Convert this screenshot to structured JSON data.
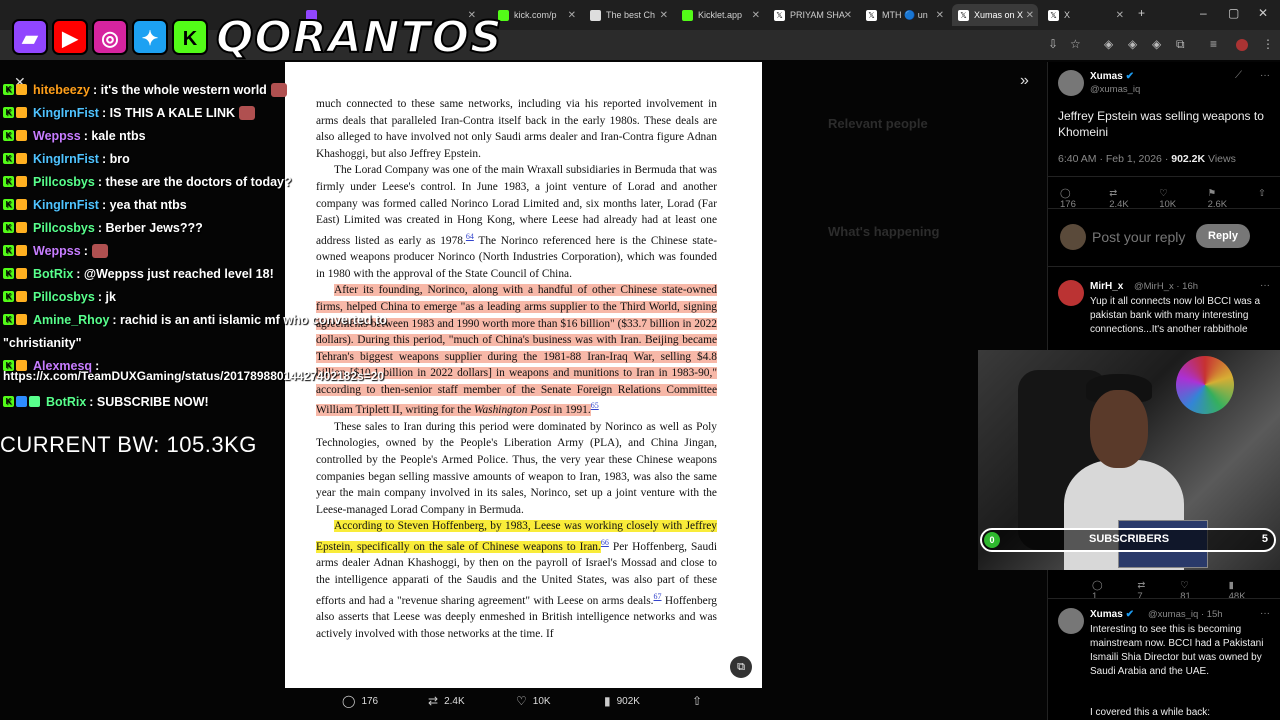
{
  "browser": {
    "tabs": [
      {
        "label": "",
        "color": "#9146ff"
      },
      {
        "label": "kick.com/p",
        "color": "#53fc18"
      },
      {
        "label": "The best Ch",
        "color": "#dddddd"
      },
      {
        "label": "Kicklet.app",
        "color": "#53fc18"
      },
      {
        "label": "PRIYAM SHA",
        "color": "#ffffff"
      },
      {
        "label": "MTH 🔵 un",
        "color": "#ffffff"
      },
      {
        "label": "Xumas on X",
        "color": "#ffffff"
      },
      {
        "label": "X",
        "color": "#ffffff"
      }
    ],
    "new_tab": "+",
    "window_controls": [
      "–",
      "▢",
      "✕"
    ]
  },
  "overlay": {
    "brand": "QORANTOS",
    "socials": [
      {
        "icon": "twitch-icon",
        "glyph": "▰",
        "color": "#9146ff"
      },
      {
        "icon": "youtube-icon",
        "glyph": "▶",
        "color": "#ff0000"
      },
      {
        "icon": "instagram-icon",
        "glyph": "◎",
        "color": "#d6249f"
      },
      {
        "icon": "twitter-icon",
        "glyph": "✦",
        "color": "#1da1f2"
      },
      {
        "icon": "kick-icon",
        "glyph": "K",
        "color": "#53fc18"
      }
    ],
    "current_bw": "CURRENT BW: 105.3KG"
  },
  "chat": [
    {
      "user": "hitebeezy",
      "color": "#ff9f1a",
      "msg": ": it's the whole western world",
      "emote": true
    },
    {
      "user": "KingIrnFist",
      "color": "#4fc3ff",
      "msg": ": IS THIS A KALE LINK",
      "emote": true
    },
    {
      "user": "Weppss",
      "color": "#c77dff",
      "msg": ": kale ntbs",
      "emote": false
    },
    {
      "user": "KingIrnFist",
      "color": "#4fc3ff",
      "msg": ": bro",
      "emote": false
    },
    {
      "user": "Pillcosbys",
      "color": "#58ff8c",
      "msg": ": these are the doctors of today?",
      "emote": false
    },
    {
      "user": "KingIrnFist",
      "color": "#4fc3ff",
      "msg": ": yea that ntbs",
      "emote": false
    },
    {
      "user": "Pillcosbys",
      "color": "#58ff8c",
      "msg": ": Berber Jews???",
      "emote": false
    },
    {
      "user": "Weppss",
      "color": "#c77dff",
      "msg": ":",
      "emote": true
    },
    {
      "user": "BotRix",
      "color": "#58ff8c",
      "msg": ": @Weppss just reached level 18!",
      "emote": false
    },
    {
      "user": "Pillcosbys",
      "color": "#58ff8c",
      "msg": ": jk",
      "emote": false
    },
    {
      "user": "Amine_Rhoy",
      "color": "#58ff8c",
      "msg": ": rachid is an anti islamic mf who converted to",
      "emote": false
    },
    {
      "user": "",
      "color": "#ffffff",
      "msg": "\"christianity\"",
      "emote": false
    },
    {
      "user": "Alexmesq",
      "color": "#c77dff",
      "msg": ":",
      "emote": false
    }
  ],
  "chat_link": "https://x.com/TeamDUXGaming/status/20178988014427402182s=20",
  "chat_last": {
    "user": "BotRix",
    "color": "#58ff8c",
    "msg": ": SUBSCRIBE NOW!"
  },
  "book": {
    "p1": "much connected to these same networks, including via his reported involvement in arms deals that paralleled Iran-Contra itself back in the early 1980s. These deals are also alleged to have involved not only Saudi arms dealer and Iran-Contra figure Adnan Khashoggi, but also Jeffrey Epstein.",
    "p2a": "The Lorad Company was one of the main Wraxall subsidiaries in Bermuda that was firmly under Leese's control. In June 1983, a joint venture of Lorad and another company was formed called Norinco Lorad Limited and, six months later, Lorad (Far East) Limited was created in Hong Kong, where Leese had already had at least one address listed as early as 1978.",
    "fn64": "64",
    "p2b": " The Norinco referenced here is the Chinese state-owned weapons producer Norinco (North Industries Corporation), which was founded in 1980 with the approval of the State Council of China.",
    "p3a": "After its founding, Norinco, along with a handful of other Chinese state-owned firms, helped China to emerge \"as a leading arms supplier to the Third World, signing agreements between 1983 and 1990 worth more than $16 billion\" ($33.7 billion in 2022 dollars). During this period, \"much of China's business was with Iran. Beijing became Tehran's biggest weapons supplier during the 1981-88 Iran-Iraq War, selling $4.8 billion [$10.1 billion in 2022 dollars] in weapons and munitions to Iran in 1983-90,\" according to then-senior staff member of the Senate Foreign Relations Committee William Triplett II, writing for the ",
    "p3_italic": "Washington Post",
    "p3b": " in 1991.",
    "fn65": "65",
    "p4": "These sales to Iran during this period were dominated by Norinco as well as Poly Technologies, owned by the People's Liberation Army (PLA), and China Jingan, controlled by the People's Armed Police. Thus, the very year these Chinese weapons companies began selling massive amounts of weapon to Iran, 1983, was also the same year the main company involved in its sales, Norinco, set up a joint venture with the Leese-managed Lorad Company in Bermuda.",
    "p5_hl": "According to Steven Hoffenberg, by 1983, Leese was working closely with Jeffrey Epstein, specifically on the sale of Chinese weapons to Iran.",
    "fn66": "66",
    "p5a": " Per Hoffenberg, Saudi arms dealer Adnan Khashoggi, by then on the payroll of Israel's Mossad and close to the intelligence apparati of the Saudis and the United States, was also part of these efforts and had a \"revenue sharing agreement\" with Leese on arms deals.",
    "fn67": "67",
    "p5b": " Hoffenberg also asserts that Leese was deeply enmeshed in British intelligence networks and was actively involved with those networks at the time. If"
  },
  "actions": {
    "replies": "176",
    "reposts": "2.4K",
    "likes": "10K",
    "views": "902K"
  },
  "tweet": {
    "name": "Xumas",
    "handle": "@xumas_iq",
    "text": "Jeffrey Epstein was selling weapons to Khomeini",
    "time": "6:40 AM · Feb 1, 2026 · ",
    "views": "902.2K",
    "views_label": " Views",
    "stats": [
      "176",
      "2.4K",
      "10K",
      "2.6K"
    ],
    "reply_placeholder": "Post your reply",
    "reply_button": "Reply"
  },
  "reply1": {
    "name": "MirH_x",
    "handle": "@MirH_x · 16h",
    "text": "Yup it all connects now lol BCCI was a pakistan bank with many interesting connections...It's another rabbithole",
    "stats": [
      "1",
      "7",
      "81",
      "48K"
    ]
  },
  "reply2": {
    "name": "Xumas",
    "handle": "@xumas_iq · 15h",
    "text": "Interesting to see this is becoming mainstream now. BCCI had a Pakistani Ismaili Shia Director but was owned by Saudi Arabia and the UAE.",
    "text2": "I covered this a while back:"
  },
  "subs": {
    "current": "0",
    "label": "SUBSCRIBERS",
    "goal": "5"
  },
  "dim": {
    "relevant": "Relevant people",
    "happening": "What's happening"
  }
}
